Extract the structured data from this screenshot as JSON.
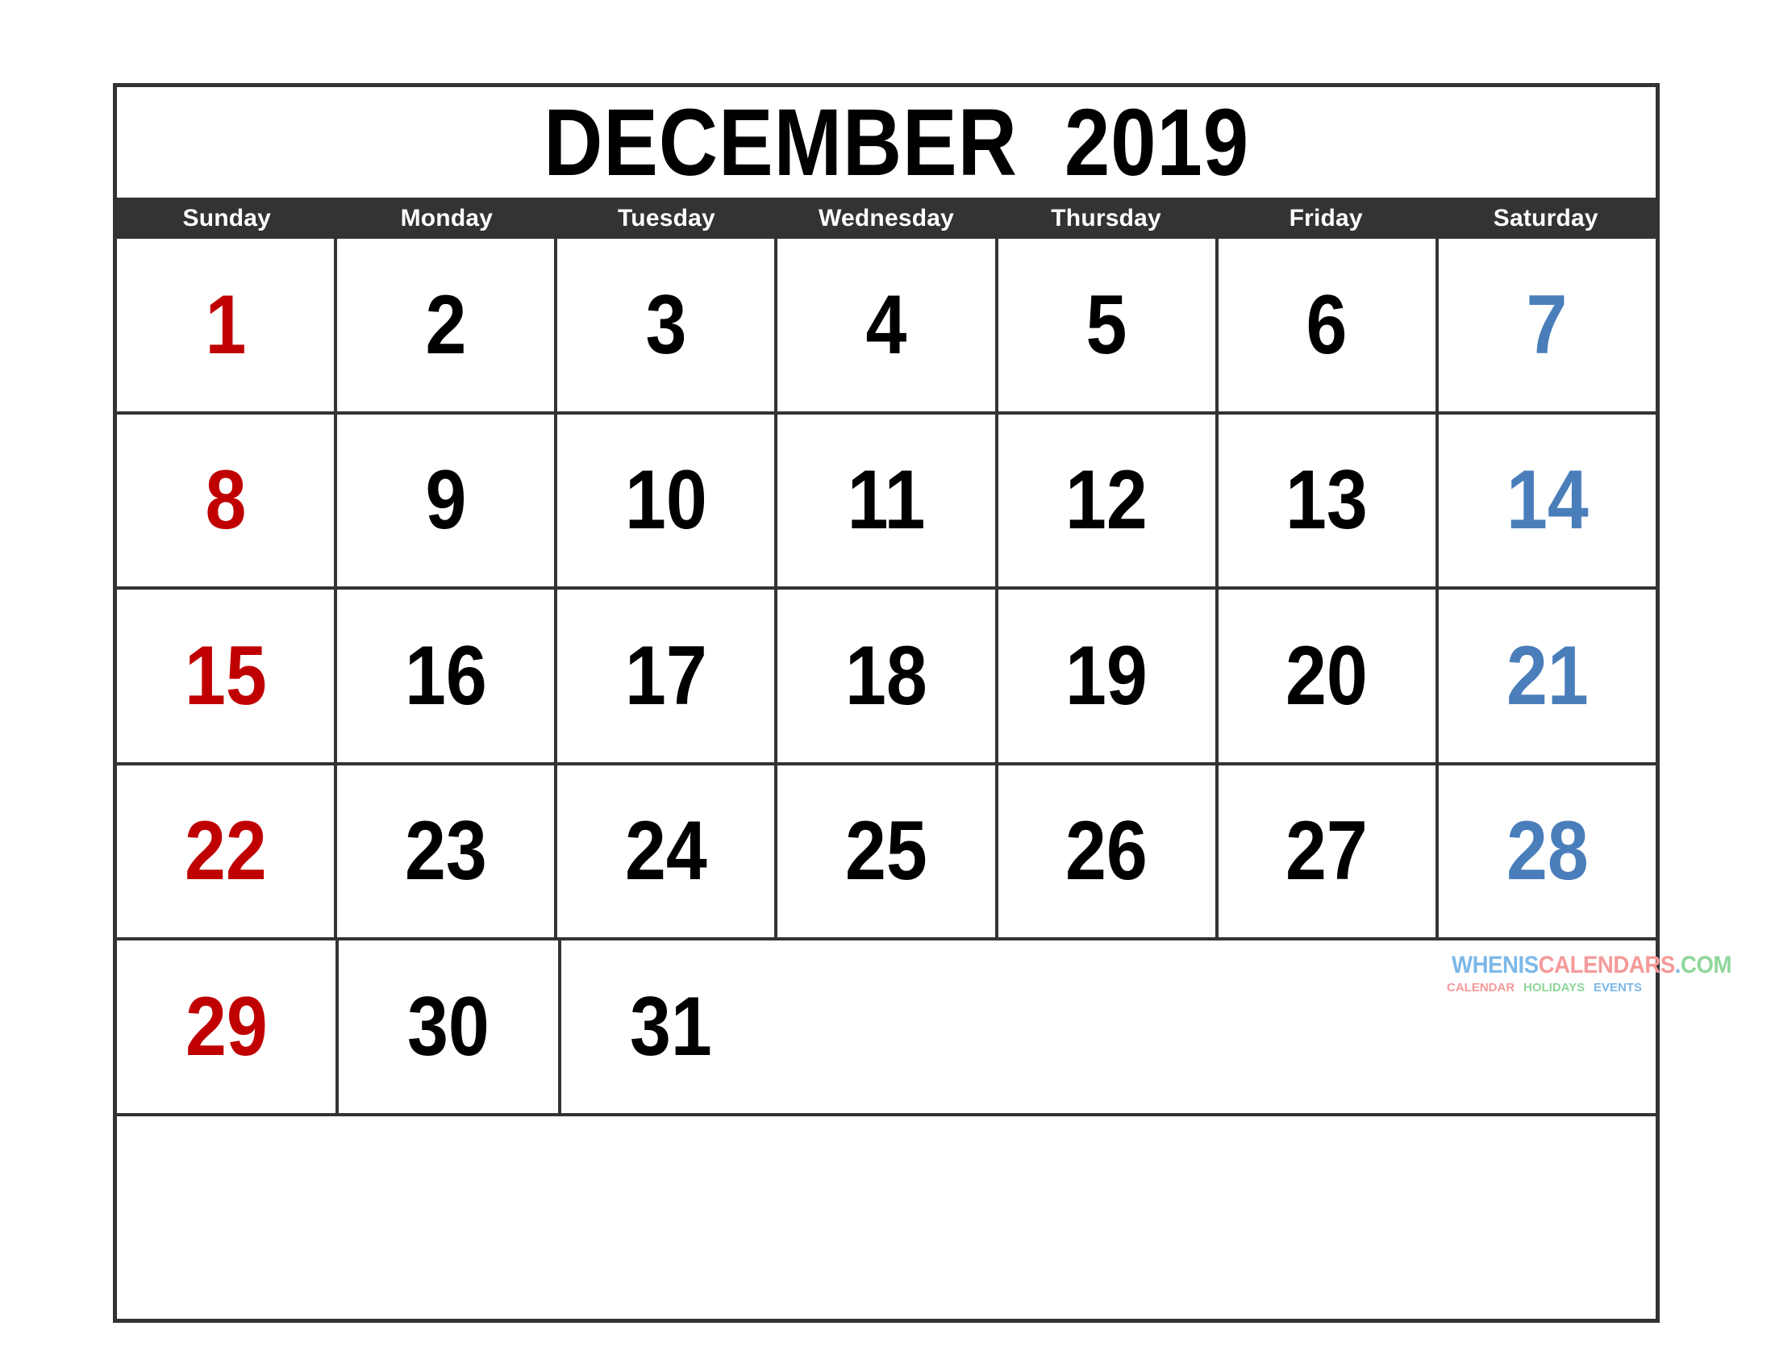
{
  "page": {
    "background_color": "#FFFFFF",
    "border_color": "#333333"
  },
  "title": {
    "text": "DECEMBER  2019",
    "month": "DECEMBER",
    "year": "2019",
    "color": "#000000"
  },
  "weekday_header": {
    "background_color": "#333333",
    "text_color": "#FFFFFF",
    "labels": [
      "Sunday",
      "Monday",
      "Tuesday",
      "Wednesday",
      "Thursday",
      "Friday",
      "Saturday"
    ]
  },
  "colors": {
    "sunday": "#C00000",
    "saturday": "#4A7EBB",
    "weekday": "#000000",
    "grid_line": "#333333"
  },
  "grid": {
    "weeks": [
      {
        "days": [
          {
            "number": "1",
            "kind": "sunday"
          },
          {
            "number": "2",
            "kind": "weekday"
          },
          {
            "number": "3",
            "kind": "weekday"
          },
          {
            "number": "4",
            "kind": "weekday"
          },
          {
            "number": "5",
            "kind": "weekday"
          },
          {
            "number": "6",
            "kind": "weekday"
          },
          {
            "number": "7",
            "kind": "saturday"
          }
        ]
      },
      {
        "days": [
          {
            "number": "8",
            "kind": "sunday"
          },
          {
            "number": "9",
            "kind": "weekday"
          },
          {
            "number": "10",
            "kind": "weekday"
          },
          {
            "number": "11",
            "kind": "weekday"
          },
          {
            "number": "12",
            "kind": "weekday"
          },
          {
            "number": "13",
            "kind": "weekday"
          },
          {
            "number": "14",
            "kind": "saturday"
          }
        ]
      },
      {
        "days": [
          {
            "number": "15",
            "kind": "sunday"
          },
          {
            "number": "16",
            "kind": "weekday"
          },
          {
            "number": "17",
            "kind": "weekday"
          },
          {
            "number": "18",
            "kind": "weekday"
          },
          {
            "number": "19",
            "kind": "weekday"
          },
          {
            "number": "20",
            "kind": "weekday"
          },
          {
            "number": "21",
            "kind": "saturday"
          }
        ]
      },
      {
        "days": [
          {
            "number": "22",
            "kind": "sunday"
          },
          {
            "number": "23",
            "kind": "weekday"
          },
          {
            "number": "24",
            "kind": "weekday"
          },
          {
            "number": "25",
            "kind": "weekday"
          },
          {
            "number": "26",
            "kind": "weekday"
          },
          {
            "number": "27",
            "kind": "weekday"
          },
          {
            "number": "28",
            "kind": "saturday"
          }
        ]
      },
      {
        "days": [
          {
            "number": "29",
            "kind": "sunday"
          },
          {
            "number": "30",
            "kind": "weekday"
          },
          {
            "number": "31",
            "kind": "weekday"
          },
          {
            "number": "",
            "kind": "blank"
          },
          {
            "number": "",
            "kind": "blank"
          },
          {
            "number": "",
            "kind": "blank"
          },
          {
            "number": "",
            "kind": "blank"
          }
        ]
      },
      {
        "days": [
          {
            "number": "",
            "kind": "blank"
          },
          {
            "number": "",
            "kind": "blank"
          },
          {
            "number": "",
            "kind": "blank"
          },
          {
            "number": "",
            "kind": "blank"
          },
          {
            "number": "",
            "kind": "blank"
          },
          {
            "number": "",
            "kind": "blank"
          },
          {
            "number": "",
            "kind": "blank"
          }
        ]
      }
    ]
  },
  "watermark": {
    "main": {
      "part1": "WHENIS",
      "part1_color": "#7CB8E8",
      "part2": "CALENDARS",
      "part2_color": "#F59A9A",
      "dot": ".",
      "dot_color": "#7CB8E8",
      "part3": "COM",
      "part3_color": "#8FD69A"
    },
    "sub": {
      "item1": "CALENDAR",
      "item1_color": "#F59A9A",
      "item2": "HOLIDAYS",
      "item2_color": "#8FD69A",
      "item3": "EVENTS",
      "item3_color": "#7CB8E8"
    }
  }
}
